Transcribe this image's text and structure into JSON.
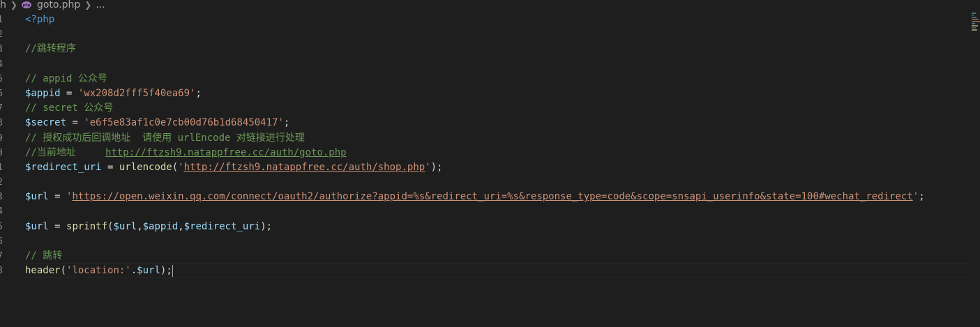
{
  "breadcrumb": {
    "folder": "h",
    "file": "goto.php",
    "more": "..."
  },
  "line_numbers": [
    "1",
    "2",
    "3",
    "4",
    "5",
    "6",
    "7",
    "8",
    "9",
    "0",
    "1",
    "2",
    "3",
    "4",
    "5",
    "6",
    "7",
    "8"
  ],
  "code": {
    "l1": "<?php",
    "l3": "//跳转程序",
    "l5": "// appid 公众号",
    "l6_var": "$appid",
    "l6_eq": " = ",
    "l6_str": "'wx208d2fff5f40ea69'",
    "l6_end": ";",
    "l7": "// secret 公众号",
    "l8_var": "$secret",
    "l8_eq": " = ",
    "l8_str": "'e6f5e83af1c0e7cb00d76b1d68450417'",
    "l8_end": ";",
    "l9": "// 授权成功后回调地址  请使用 urlEncode 对链接进行处理",
    "l10_prefix": "//当前地址     ",
    "l10_link": "http://ftzsh9.natappfree.cc/auth/goto.php",
    "l11_var": "$redirect_uri",
    "l11_eq": " = ",
    "l11_fn": "urlencode",
    "l11_open": "(",
    "l11_q1": "'",
    "l11_link": "http://ftzsh9.natappfree.cc/auth/shop.php",
    "l11_q2": "'",
    "l11_end": ");",
    "l13_var": "$url",
    "l13_eq": " = ",
    "l13_q1": "'",
    "l13_link": "https://open.weixin.qq.com/connect/oauth2/authorize?appid=%s&redirect_uri=%s&response_type=code&scope=snsapi_userinfo&state=100#wechat_redirect",
    "l13_q2": "'",
    "l13_end": ";",
    "l15_var": "$url",
    "l15_eq": " = ",
    "l15_fn": "sprintf",
    "l15_open": "(",
    "l15_a1": "$url",
    "l15_c1": ",",
    "l15_a2": "$appid",
    "l15_c2": ",",
    "l15_a3": "$redirect_uri",
    "l15_end": ");",
    "l17": "// 跳转",
    "l18_fn": "header",
    "l18_open": "(",
    "l18_str": "'location:'",
    "l18_dot": ".",
    "l18_var": "$url",
    "l18_end": ");"
  },
  "colors": {
    "background": "#1e1e1e",
    "comment": "#6a9955",
    "variable": "#9cdcfe",
    "string": "#ce9178",
    "function": "#dcdcaa",
    "keyword": "#569cd6"
  }
}
